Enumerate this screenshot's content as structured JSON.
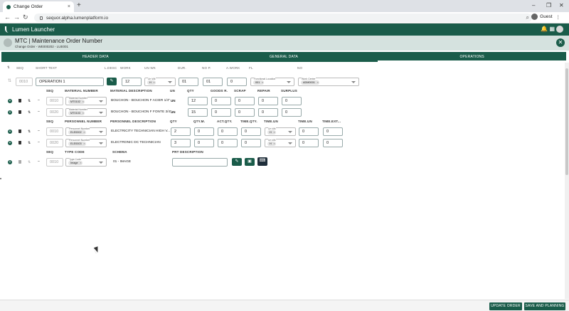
{
  "browser": {
    "tab_title": "Change Order",
    "tab_close": "×",
    "new_tab": "+",
    "url": "sequor.alpha.lumenplatform.io",
    "profile": "Guest",
    "minimize": "–",
    "maximize": "❐",
    "close": "✕",
    "back": "←",
    "forward": "→",
    "reload": "↻",
    "zoom_icon": "⌕",
    "menu_icon": "⋮"
  },
  "app": {
    "title": "Lumen Launcher",
    "accent": "#1a5c4a",
    "bell_icon": "🔔",
    "apps_icon": "▦"
  },
  "page": {
    "title": "MTC | Maintenance Order Number",
    "subtitle": "Change Order - WE000202 - LUE001",
    "close": "✕"
  },
  "section_tabs": [
    "HEADER DATA",
    "GENERAL DATA",
    "OPERATIONS"
  ],
  "operations": {
    "headers": [
      "SEQ",
      "SHORT TEXT",
      "L.DESC",
      "WORK",
      "UN WK",
      "DUR.",
      "NO P.",
      "A.WORK",
      "FL",
      "NO",
      "Work Center"
    ],
    "row": {
      "seq": "0010",
      "short_text": "OPERATION 1",
      "work": "12",
      "un_wk_label": "Un Wk",
      "un_wk_value": "H",
      "dur": "01",
      "no_p": "01",
      "a_work": "0",
      "fl_label": "Functional Location",
      "fl_value": "001",
      "wc_label": "Work Center",
      "wc_value": "ADM0001"
    },
    "edit_icon": "✎"
  },
  "materials": {
    "headers": [
      "SEQ",
      "MATERIAL NUMBER",
      "MATERIAL DESCRIPTION",
      "UN",
      "QTY",
      "GOODS R.",
      "SCRAP",
      "REPAIR",
      "SURPLUS"
    ],
    "field_label": "Material Number",
    "rows": [
      {
        "seq": "0010",
        "number": "MT0102",
        "description": "BOUCHON - BOUCHON F ACIER 1/4\"",
        "un": "UN",
        "qty": "12",
        "goods": "0",
        "scrap": "0",
        "repair": "0",
        "surplus": "0"
      },
      {
        "seq": "0020",
        "number": "MT0103",
        "description": "BOUCHON - BOUCHON F FONTE 3/4\"",
        "un": "UN",
        "qty": "15",
        "goods": "0",
        "scrap": "0",
        "repair": "0",
        "surplus": "0"
      }
    ]
  },
  "personnel": {
    "headers": [
      "SEQ",
      "PERSONNEL NUMBER",
      "PERSONNEL DESCRIPTION",
      "QTY",
      "QTY.M.",
      "ACT.QTY.",
      "TIME.QTY.",
      "TIME.UN",
      "TIME.UN",
      "TIME.EXT..."
    ],
    "field_label": "Personnel Number",
    "unit_label": "Un Wk",
    "rows": [
      {
        "seq": "0010",
        "number": "ELE0002",
        "description": "ELECTRICITY TECHNICIAN HIGH V...",
        "qty": "2",
        "qty_m": "0",
        "act_qty": "0",
        "time_qty": "0",
        "time_un": "H",
        "time_un2": "0",
        "time_ext": "0"
      },
      {
        "seq": "0020",
        "number": "ELE0003",
        "description": "ELECTRONIC DC TECHNICIAN",
        "qty": "3",
        "qty_m": "0",
        "act_qty": "0",
        "time_qty": "0",
        "time_un": "H",
        "time_un2": "0",
        "time_ext": "0"
      }
    ]
  },
  "documents": {
    "headers": [
      "SEQ",
      "TYPE CODE",
      "SCHEMA",
      "PRT DESCRIPTION"
    ],
    "field_label": "Type Code",
    "row": {
      "seq": "0010",
      "type": "Image",
      "schema": "01 - IMAGE",
      "prt": ""
    }
  },
  "row_icons": {
    "add": "+",
    "delete": "🗑",
    "move": "⇅",
    "dash": "–"
  },
  "footer": {
    "update": "UPDATE ORDER",
    "save": "SAVE AND PLANNING"
  }
}
